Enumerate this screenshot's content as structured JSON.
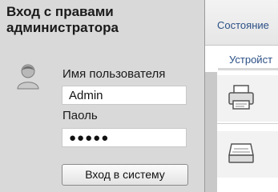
{
  "login": {
    "title": "Вход с правами администратора",
    "username_label": "Имя пользователя",
    "username_value": "Admin",
    "password_label": "Паоль",
    "password_value": "●●●●●",
    "submit_label": "Вход в систему"
  },
  "nav": {
    "status_tab": "Состояние",
    "device_tab": "Устройст"
  },
  "icons": {
    "avatar": "user-avatar-icon",
    "printer": "printer-icon",
    "scanner": "scanner-icon"
  },
  "colors": {
    "panel_bg": "#d9d9d9",
    "link_blue": "#2b4f86"
  }
}
